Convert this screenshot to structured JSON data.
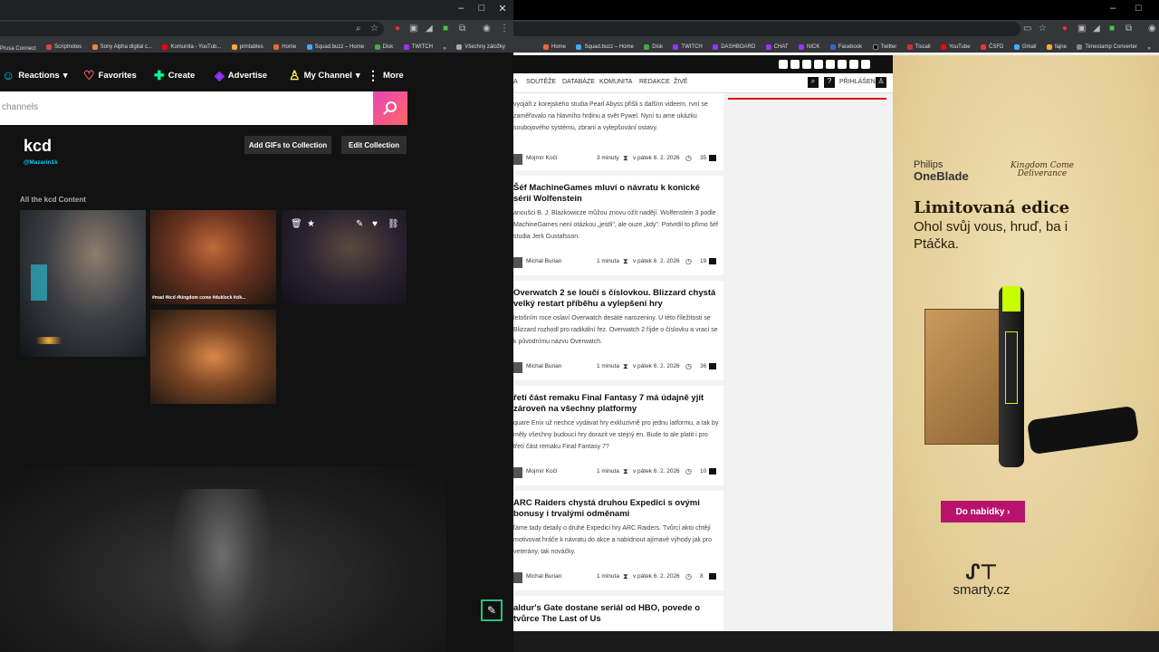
{
  "left_browser": {
    "bookmarks": [
      "Prusa Connect",
      "Scriptnotes",
      "Sony Alpha digital c...",
      "Komunita - YouTub...",
      "printables",
      "Home",
      "Squad.buzz – Home",
      "Disk",
      "TWITCH",
      "»",
      "Všechny záložky"
    ],
    "giphy": {
      "nav": [
        {
          "label": "Reactions",
          "icon": "☺",
          "chev": "▾",
          "color": "#00ccff"
        },
        {
          "label": "Favorites",
          "icon": "♡",
          "chev": "",
          "color": "#ff6666"
        },
        {
          "label": "Create",
          "icon": "✚",
          "chev": "",
          "color": "#00ff99"
        },
        {
          "label": "Advertise",
          "icon": "◈",
          "chev": "",
          "color": "#9933ff"
        },
        {
          "label": "My Channel",
          "icon": "♙",
          "chev": "▾",
          "color": "#fff35c"
        },
        {
          "label": "More",
          "icon": "",
          "chev": "",
          "color": "#fff"
        }
      ],
      "search_placeholder": "channels",
      "collection_title": "kcd",
      "collection_handle": "@Mazarin1k",
      "add_gifs_label": "Add GIFs to Collection",
      "edit_collection_label": "Edit Collection",
      "section_label": "All the kcd Content",
      "gif_tagline": "#mad #kcd #kingdom come #duklock #zik..."
    }
  },
  "right_browser": {
    "bookmarks": [
      "Home",
      "Squad.buzz – Home",
      "Disk",
      "TWITCH",
      "DASHBOARD",
      "CHAT",
      "NICK",
      "Facebook",
      "Twitter",
      "Tiscali",
      "YouTube",
      "ČSFD",
      "Gmail",
      "fajne",
      "Timestamp Converter",
      "»"
    ],
    "site_nav": [
      "SOUTĚŽE",
      "DATABÁZE",
      "KOMUNITA",
      "REDAKCE",
      "ŽIVĚ"
    ],
    "login_label": "PŘIHLÁŠENÍ",
    "articles": [
      {
        "title": "",
        "text": "vyojáři z korejského studia Pearl Abyss přišli s dalším videem. rvní se zaměřovalo na hlavního hrdinu a svět Pywel. Nyní tu ame ukázku soubojového systému, zbraní a vylepšování ostavy.",
        "author": "Mojmír Kočí",
        "time": "3 minuty",
        "date": "v pátek 6. 2. 2026",
        "count": "35"
      },
      {
        "title": "Šéf MachineGames mluví o návratu k konické sérii Wolfenstein",
        "text": "anoušci B. J. Blazkowicze můžou znovu ožít nadějí. Wolfenstein 3 podle MachineGames není otázkou „jestli\", ale ouze „kdy\". Potvrdil to přímo šéf studia Jerk Gustafsson.",
        "author": "Michal Burian",
        "time": "1 minuta",
        "date": "v pátek 6. 2. 2026",
        "count": "19"
      },
      {
        "title": "Overwatch 2 se loučí s číslovkou. Blizzard chystá velký restart příběhu a vylepšení hry",
        "text": "letošním roce oslaví Overwatch desáté narozeniny. U této říležitosti se Blizzard rozhodl pro radikální řez. Overwatch 2 řijde o číslovku a vrací se k původnímu názvu Overwatch.",
        "author": "Michal Burian",
        "time": "1 minuta",
        "date": "v pátek 6. 2. 2026",
        "count": "36"
      },
      {
        "title": "řetí část remaku Final Fantasy 7 má údajně yjít zároveň na všechny platformy",
        "text": "quare Enix už nechce vydávat hry exkluzivně pro jednu latformu, a tak by měly všechny budoucí hry dorazit ve stejný en. Bude to ale platit i pro třetí část remaku Final Fantasy 7?",
        "author": "Mojmír Kočí",
        "time": "1 minuta",
        "date": "v pátek 6. 2. 2026",
        "count": "10"
      },
      {
        "title": "ARC Raiders chystá druhou Expedici s ovými bonusy i trvalými odměnami",
        "text": "ľáme tady detaily o druhé Expedici hry ARC Raiders. Tvůrci akto chtějí motivovat hráče k návratu do akce a nabídnout ajímavé výhody jak pro veterány, tak nováčky.",
        "author": "Michal Burian",
        "time": "1 minuta",
        "date": "v pátek 6. 2. 2026",
        "count": "8"
      },
      {
        "title": "aldur's Gate dostane seriál od HBO, povede o tvůrce The Last of Us",
        "text": "",
        "author": "",
        "time": "",
        "date": "",
        "count": ""
      }
    ],
    "ad": {
      "brand_line1": "Philips",
      "brand_line2": "OneBlade",
      "game_logo": "Kingdom Come Deliverance",
      "title": "Limitovaná edice",
      "subtitle": "Ohol svůj vous, hruď, ba i Ptáčka.",
      "button_label": "Do nabídky ›",
      "shop_logo": "smarty.cz"
    }
  }
}
